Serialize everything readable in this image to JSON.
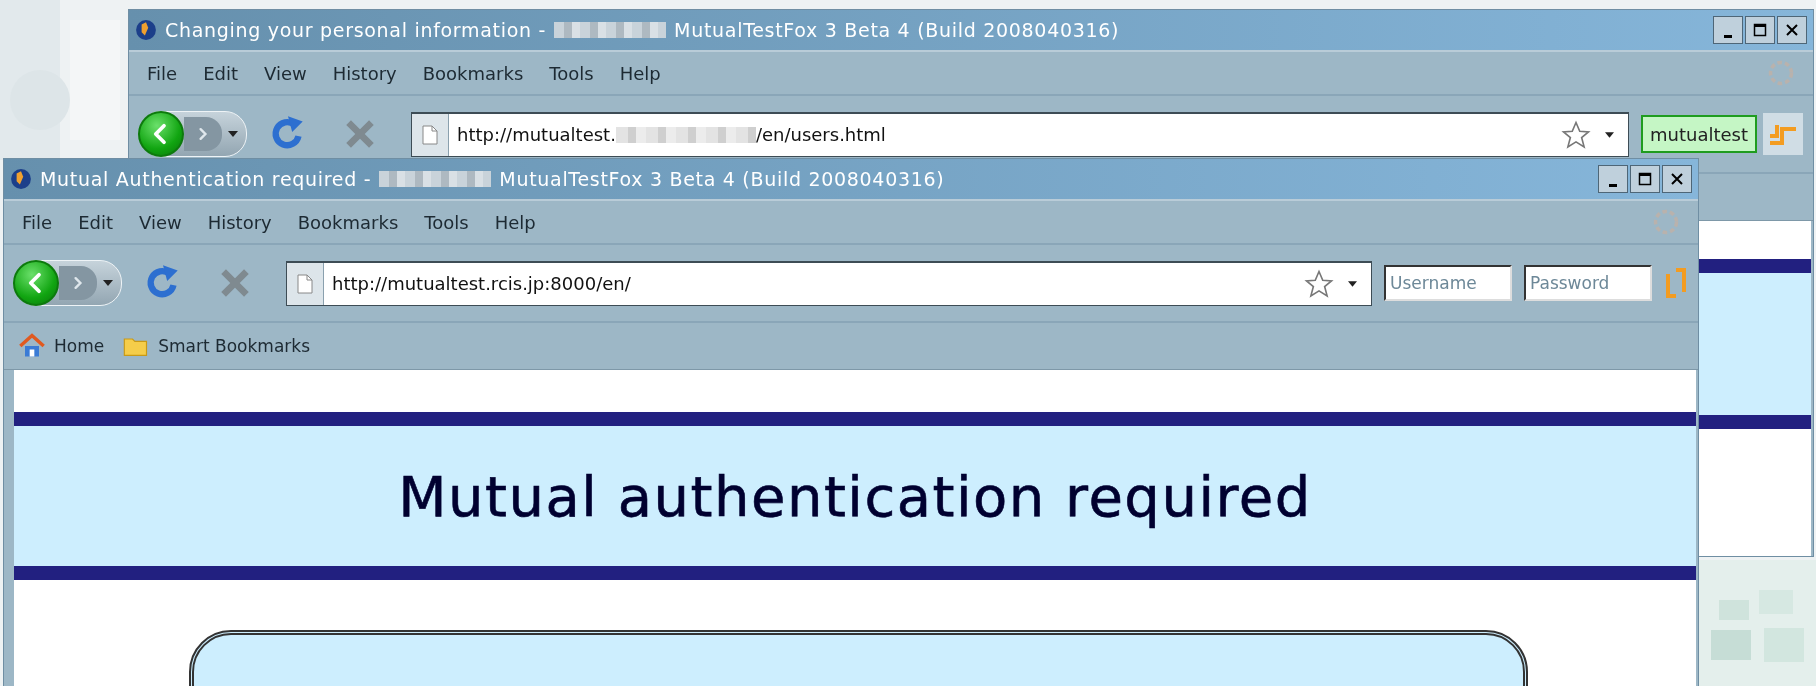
{
  "windows": [
    {
      "title": [
        {
          "kind": "text",
          "text": "Changing your personal information -"
        },
        {
          "kind": "redacted"
        },
        {
          "kind": "text",
          "text": "MutualTestFox 3 Beta 4 (Build 2008040316)"
        }
      ],
      "menu": [
        "File",
        "Edit",
        "View",
        "History",
        "Bookmarks",
        "Tools",
        "Help"
      ],
      "url": [
        {
          "kind": "text",
          "text": "http://mutualtest."
        },
        {
          "kind": "redacted"
        },
        {
          "kind": "text",
          "text": "/en/users.html"
        }
      ],
      "login": {
        "kind": "account",
        "username": "mutualtest"
      }
    },
    {
      "title": [
        {
          "kind": "text",
          "text": "Mutual Authentication required -"
        },
        {
          "kind": "redacted"
        },
        {
          "kind": "text",
          "text": "MutualTestFox 3 Beta 4 (Build 2008040316)"
        }
      ],
      "menu": [
        "File",
        "Edit",
        "View",
        "History",
        "Bookmarks",
        "Tools",
        "Help"
      ],
      "url": [
        {
          "kind": "text",
          "text": "http://mutualtest.rcis.jp:8000/en/"
        }
      ],
      "login": {
        "kind": "fields",
        "username_placeholder": "Username",
        "password_placeholder": "Password"
      },
      "bookmarks": [
        {
          "kind": "home",
          "label": "Home"
        },
        {
          "kind": "folder",
          "label": "Smart Bookmarks"
        }
      ],
      "heading": "Mutual authentication required"
    }
  ]
}
